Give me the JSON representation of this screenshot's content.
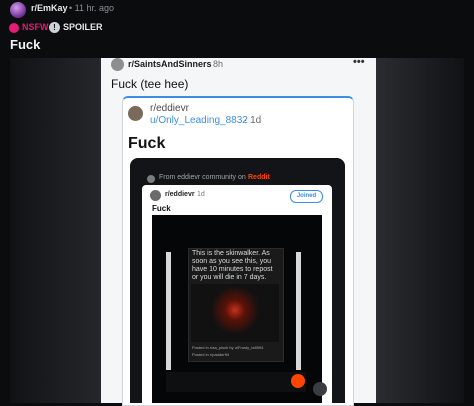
{
  "header": {
    "subreddit": "r/EmKay",
    "time": "• 11 hr. ago",
    "nsfw_label": "NSFW",
    "spoiler_label": "SPOILER",
    "spoiler_icon": "!"
  },
  "post": {
    "title": "Fuck"
  },
  "screenshot": {
    "subreddit": "r/SaintsAndSinners",
    "time": "8h",
    "more": "•••",
    "title": "Fuck (tee hee)",
    "crosspost": {
      "subreddit": "r/eddievr",
      "user": "u/Only_Leading_8832",
      "time": "· 1d",
      "title": "Fuck",
      "embed": {
        "from_text": "From eddievr community on",
        "from_link": "Reddit",
        "subreddit": "r/eddievr",
        "time": "1d",
        "joined_label": "Joined",
        "title": "Fuck",
        "meme_text": "This is the skinwalker. As soon as you see this, you have 10 minutes to repost or you will die in 7 days.",
        "footer_1": "Posted in r/aa_plsch by u/Frosty_tx8994",
        "footer_2": "Posted in r/padder94"
      }
    }
  },
  "colors": {
    "background": "#0b0c0d",
    "nsfw": "#e11d74",
    "link_blue": "#3a8ee6",
    "reddit_orange": "#ff4500"
  }
}
